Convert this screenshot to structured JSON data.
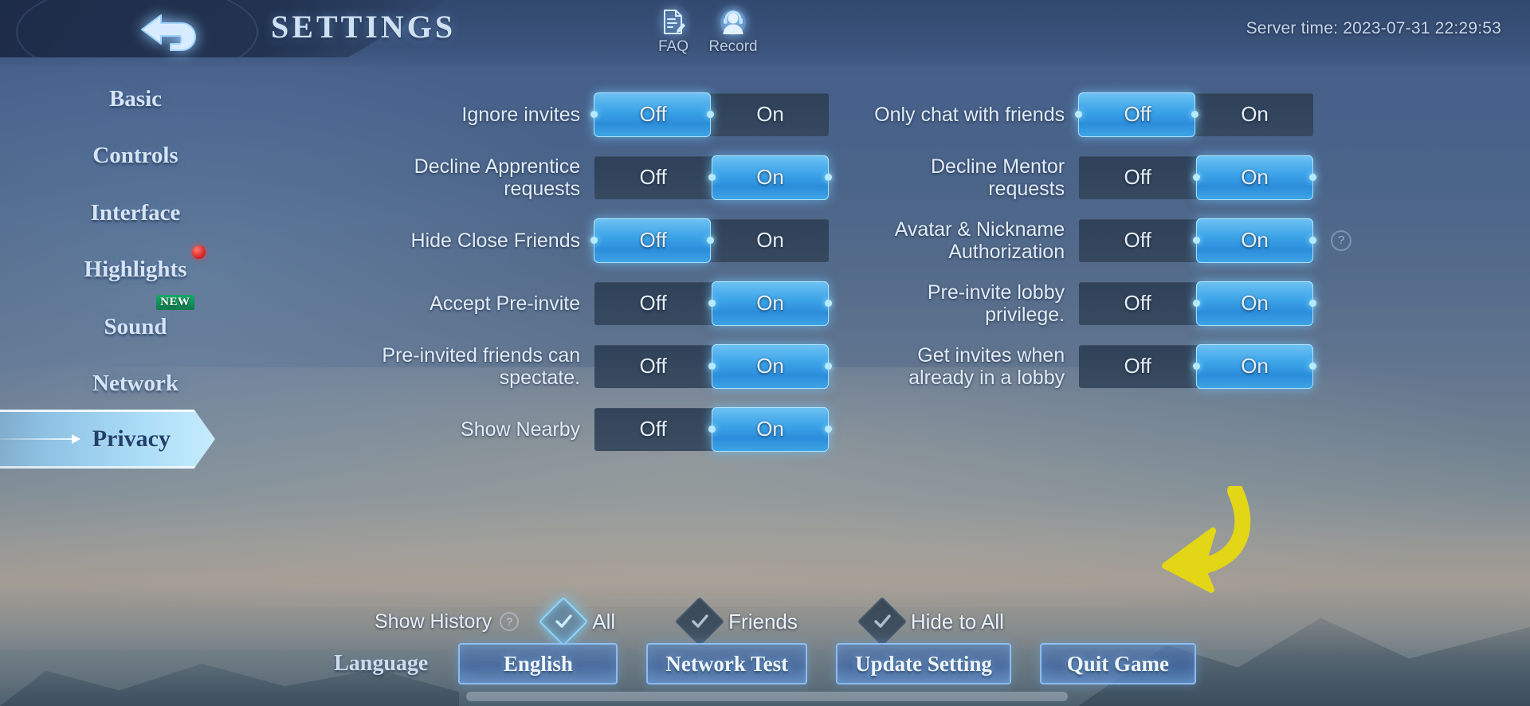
{
  "header": {
    "title": "SETTINGS",
    "back_icon": "back-arrow-icon",
    "faq_label": "FAQ",
    "record_label": "Record",
    "server_time": "Server time: 2023-07-31 22:29:53"
  },
  "sidebar": {
    "items": [
      {
        "label": "Basic",
        "active": false,
        "badge": ""
      },
      {
        "label": "Controls",
        "active": false,
        "badge": ""
      },
      {
        "label": "Interface",
        "active": false,
        "badge": ""
      },
      {
        "label": "Highlights",
        "active": false,
        "badge": "dot"
      },
      {
        "label": "Sound",
        "active": false,
        "badge": "NEW"
      },
      {
        "label": "Network",
        "active": false,
        "badge": ""
      },
      {
        "label": "Privacy",
        "active": true,
        "badge": ""
      }
    ]
  },
  "settings": {
    "toggle_off_label": "Off",
    "toggle_on_label": "On",
    "left_column": [
      {
        "label": "Ignore invites",
        "value": "Off"
      },
      {
        "label": "Decline Apprentice requests",
        "value": "On"
      },
      {
        "label": "Hide Close Friends",
        "value": "Off"
      },
      {
        "label": "Accept Pre-invite",
        "value": "On"
      },
      {
        "label": "Pre-invited friends can spectate.",
        "value": "On"
      },
      {
        "label": "Show Nearby",
        "value": "On"
      }
    ],
    "right_column": [
      {
        "label": "Only chat with friends",
        "value": "Off",
        "help": false
      },
      {
        "label": "Decline Mentor requests",
        "value": "On",
        "help": false
      },
      {
        "label": "Avatar & Nickname Authorization",
        "value": "On",
        "help": true
      },
      {
        "label": "Pre-invite lobby privilege.",
        "value": "On",
        "help": false
      },
      {
        "label": "Get invites when already in a lobby",
        "value": "On",
        "help": false
      }
    ]
  },
  "history": {
    "label": "Show History",
    "help_icon": "question-mark-icon",
    "options": [
      {
        "label": "All",
        "selected": true
      },
      {
        "label": "Friends",
        "selected": false
      },
      {
        "label": "Hide to All",
        "selected": false
      }
    ]
  },
  "annotation": {
    "type": "curved-arrow",
    "color": "#e3d617",
    "points_to": "Hide to All"
  },
  "bottom_bar": {
    "language_label": "Language",
    "buttons": [
      {
        "label": "English"
      },
      {
        "label": "Network Test"
      },
      {
        "label": "Update Setting"
      },
      {
        "label": "Quit Game"
      }
    ]
  }
}
